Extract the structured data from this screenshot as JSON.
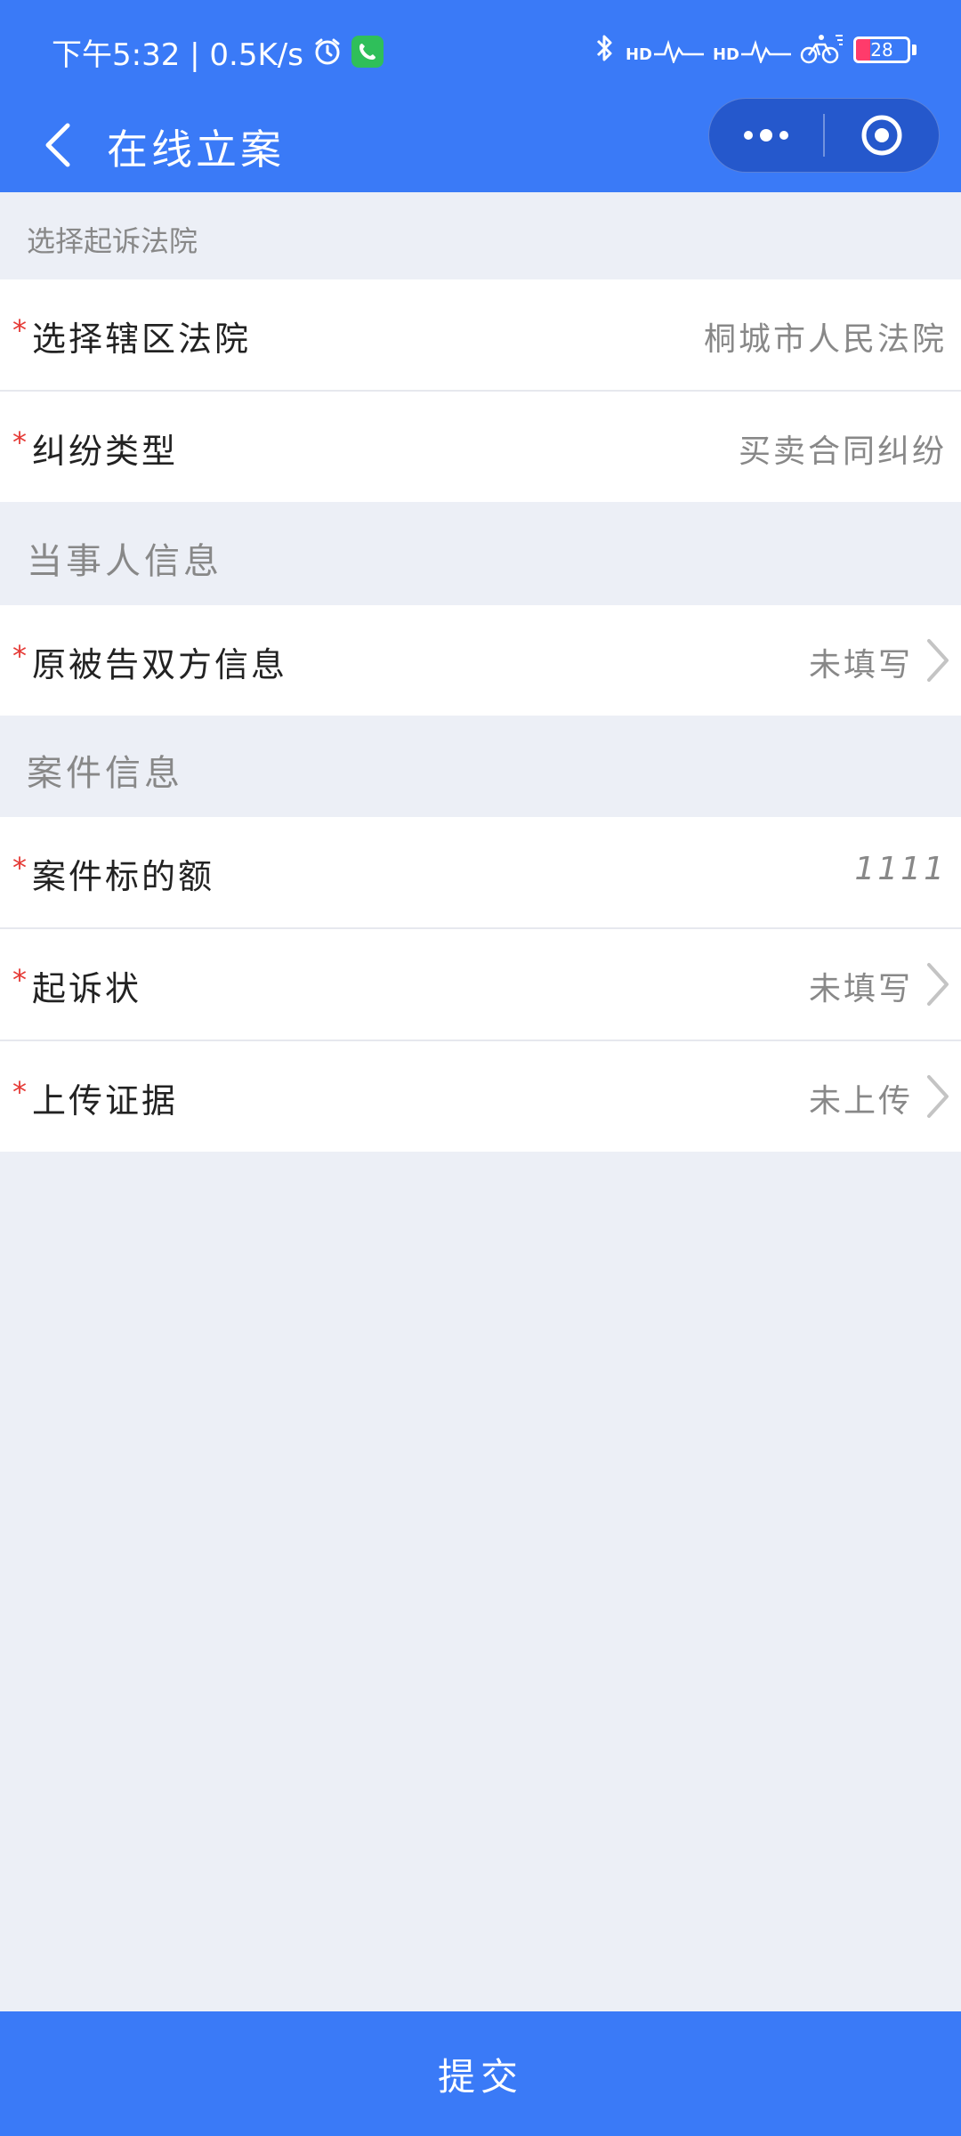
{
  "status_bar": {
    "left_text": "下午5:32 | 0.5K/s",
    "hd1": "HD",
    "hd2": "HD",
    "battery": "28",
    "icons": [
      "alarm-icon",
      "wechat-icon",
      "bluetooth-icon",
      "signal-icon",
      "cycling-icon",
      "battery-icon"
    ]
  },
  "nav": {
    "title": "在线立案",
    "icons": [
      "back-arrow-icon",
      "more-icon",
      "target-icon"
    ]
  },
  "sections": [
    {
      "title": "选择起诉法院",
      "rows": [
        {
          "label": "选择辖区法院",
          "value": "桐城市人民法院",
          "required": "*"
        },
        {
          "label": "纠纷类型",
          "value": "买卖合同纠纷",
          "required": "*"
        }
      ]
    },
    {
      "title": "当事人信息",
      "rows": [
        {
          "label": "原被告双方信息",
          "value": "未填写",
          "required": "*"
        }
      ]
    },
    {
      "title": "案件信息",
      "rows": [
        {
          "label": "案件标的额",
          "value": "1111",
          "required": "*"
        },
        {
          "label": "起诉状",
          "value": "未填写",
          "required": "*"
        },
        {
          "label": "上传证据",
          "value": "未上传",
          "required": "*"
        }
      ]
    }
  ],
  "submit_label": "提交",
  "colors": {
    "header": "#3a7af7",
    "background": "#eceff6",
    "required": "#e53935",
    "muted_text": "#888888"
  }
}
